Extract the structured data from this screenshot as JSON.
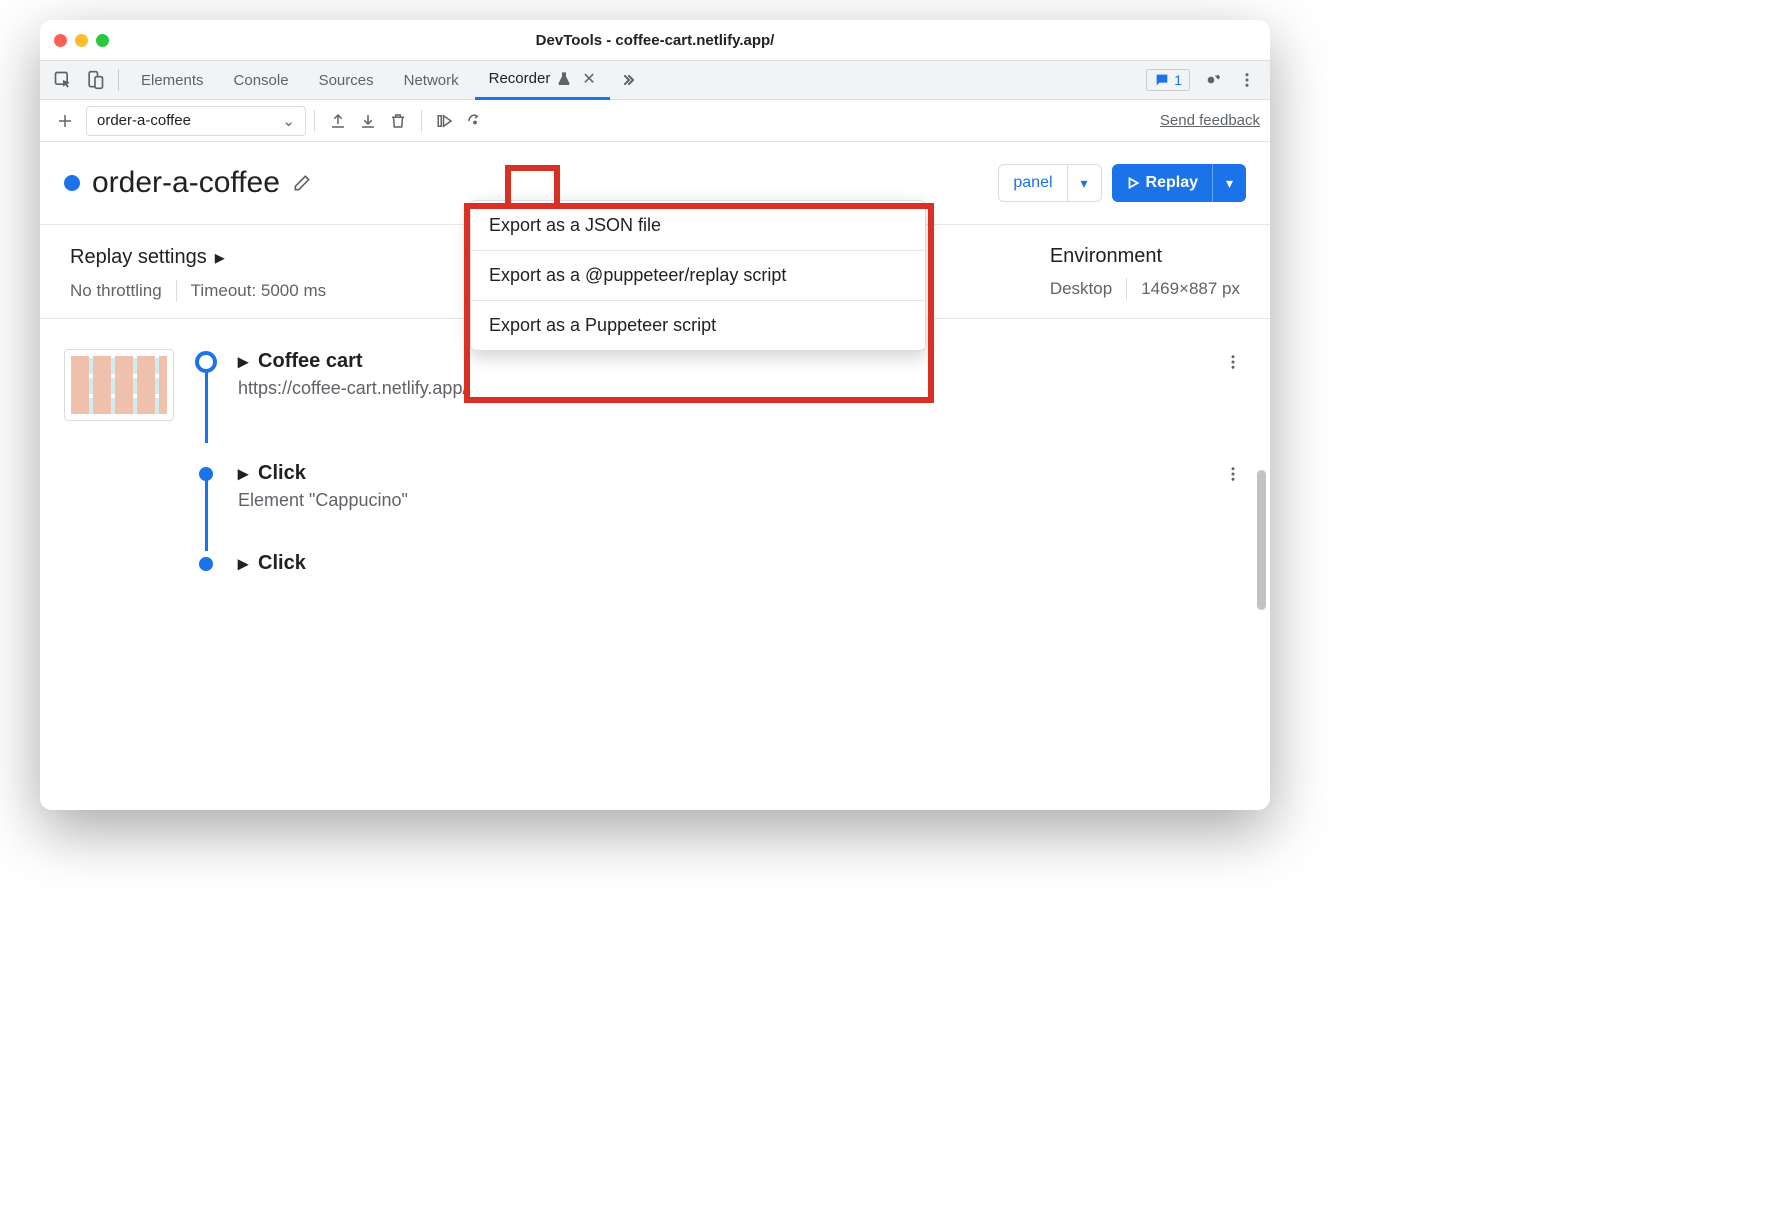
{
  "window": {
    "title": "DevTools - coffee-cart.netlify.app/"
  },
  "tabs": {
    "items": [
      "Elements",
      "Console",
      "Sources",
      "Network",
      "Recorder"
    ],
    "active": "Recorder",
    "badge_count": "1"
  },
  "toolbar": {
    "selected_recording": "order-a-coffee",
    "feedback": "Send feedback"
  },
  "recording": {
    "name": "order-a-coffee",
    "panel_button": "panel",
    "replay_button": "Replay"
  },
  "export_menu": {
    "items": [
      "Export as a JSON file",
      "Export as a @puppeteer/replay script",
      "Export as a Puppeteer script"
    ]
  },
  "settings": {
    "replay_title": "Replay settings",
    "throttling": "No throttling",
    "timeout": "Timeout: 5000 ms",
    "env_title": "Environment",
    "device": "Desktop",
    "viewport": "1469×887 px"
  },
  "steps": [
    {
      "title": "Coffee cart",
      "sub": "https://coffee-cart.netlify.app/",
      "has_thumb": true,
      "dot": "open"
    },
    {
      "title": "Click",
      "sub": "Element \"Cappucino\"",
      "has_thumb": false,
      "dot": "filled"
    },
    {
      "title": "Click",
      "sub": "",
      "has_thumb": false,
      "dot": "filled"
    }
  ]
}
